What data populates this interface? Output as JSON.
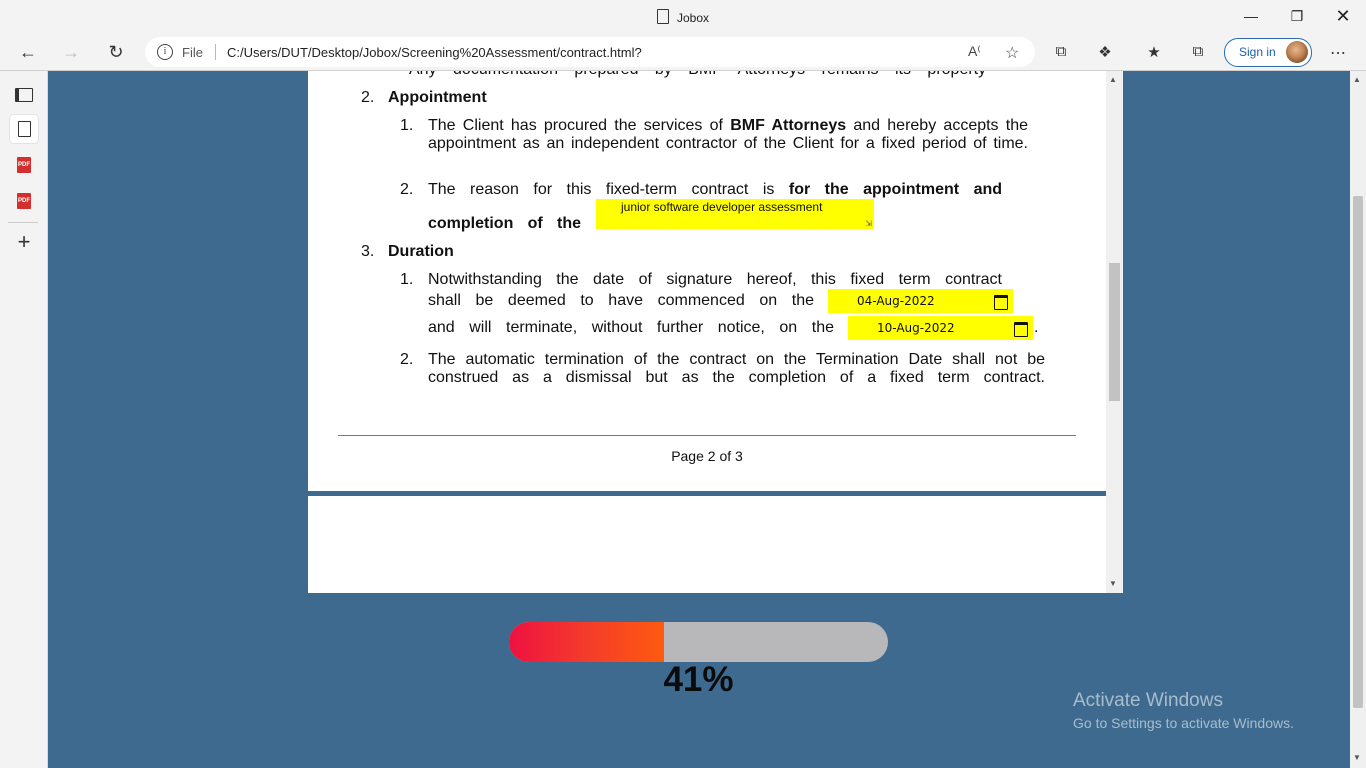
{
  "window": {
    "title": "Jobox"
  },
  "navbar": {
    "scheme": "File",
    "url": "C:/Users/DUT/Desktop/Jobox/Screening%20Assessment/contract.html?",
    "signin_label": "Sign in"
  },
  "document": {
    "clipped_line": "Any documentation prepared by BMF Attorneys remains its property",
    "section2": {
      "number": "2.",
      "heading": "Appointment",
      "item1": {
        "number": "1.",
        "text_before": "The Client has procured the services of",
        "bold": "BMF Attorneys",
        "text_after": "and hereby accepts the appointment as an independent contractor of the Client for a fixed period of time."
      },
      "item2": {
        "number": "2.",
        "text_before": "The reason for this fixed-term contract is",
        "bold_line1": "for the appointment and",
        "bold_line2": "completion of the",
        "field_value": "junior software developer assessment"
      }
    },
    "section3": {
      "number": "3.",
      "heading": "Duration",
      "item1": {
        "number": "1.",
        "line1": "Notwithstanding the date of signature hereof, this fixed term contract",
        "line2": "shall be deemed to have commenced on the",
        "start_date": "04-Aug-2022",
        "line3": "and will terminate, without further notice, on the",
        "end_date": "10-Aug-2022",
        "end_punct": "."
      },
      "item2": {
        "number": "2.",
        "text": "The automatic termination of the contract on the Termination Date shall not be construed as a dismissal but as the completion of a fixed term contract."
      }
    },
    "footer": "Page 2 of 3"
  },
  "progress": {
    "value": 41,
    "label": "41%"
  },
  "watermark": {
    "line1": "Activate Windows",
    "line2": "Go to Settings to activate Windows."
  },
  "icons": {
    "back": "back-arrow-icon",
    "forward": "forward-arrow-icon",
    "refresh": "refresh-icon",
    "info": "info-icon",
    "read_aloud": "read-aloud-icon",
    "favorite_add": "add-favorite-icon",
    "collections": "collections-icon",
    "extensions": "extensions-icon",
    "favorites": "favorites-icon",
    "workspaces": "workspaces-icon",
    "more": "more-icon",
    "calendar": "calendar-icon"
  },
  "colors": {
    "highlight": "#ffff00",
    "page_bg": "#3d6a8e",
    "progress_start": "#ee1142",
    "progress_end": "#ff5a10",
    "progress_track": "#b8b8ba"
  }
}
